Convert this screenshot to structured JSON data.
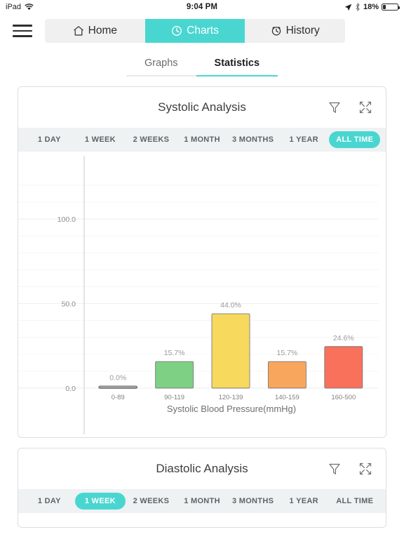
{
  "status_bar": {
    "device": "iPad",
    "wifi_icon": "wifi-icon",
    "time": "9:04 PM",
    "location_icon": "location-arrow-icon",
    "bluetooth_icon": "bluetooth-icon",
    "battery_percent": "18%",
    "battery_level": 18
  },
  "topnav": {
    "menu_icon": "hamburger-menu-icon",
    "tabs": [
      {
        "label": "Home",
        "icon": "home-icon",
        "active": false
      },
      {
        "label": "Charts",
        "icon": "clock-icon",
        "active": true
      },
      {
        "label": "History",
        "icon": "alarm-clock-icon",
        "active": false
      }
    ]
  },
  "subtabs": [
    {
      "label": "Graphs",
      "active": false
    },
    {
      "label": "Statistics",
      "active": true
    }
  ],
  "theme": {
    "accent": "#4ad6d0",
    "range_bar_bg": "#eef2f3",
    "card_border": "#dedede",
    "text": "#3d3d3d",
    "muted": "#8a8a8a"
  },
  "cards": [
    {
      "title": "Systolic Analysis",
      "filter_icon": "filter-funnel-icon",
      "expand_icon": "expand-fullscreen-icon",
      "ranges": [
        {
          "label": "1 DAY",
          "active": false
        },
        {
          "label": "1 WEEK",
          "active": false
        },
        {
          "label": "2 WEEKS",
          "active": false
        },
        {
          "label": "1 MONTH",
          "active": false
        },
        {
          "label": "3 MONTHS",
          "active": false
        },
        {
          "label": "1 YEAR",
          "active": false
        },
        {
          "label": "ALL TIME",
          "active": true
        }
      ]
    },
    {
      "title": "Diastolic Analysis",
      "filter_icon": "filter-funnel-icon",
      "expand_icon": "expand-fullscreen-icon",
      "ranges": [
        {
          "label": "1 DAY",
          "active": false
        },
        {
          "label": "1 WEEK",
          "active": true
        },
        {
          "label": "2 WEEKS",
          "active": false
        },
        {
          "label": "1 MONTH",
          "active": false
        },
        {
          "label": "3 MONTHS",
          "active": false
        },
        {
          "label": "1 YEAR",
          "active": false
        },
        {
          "label": "ALL TIME",
          "active": false
        }
      ]
    }
  ],
  "chart_data": {
    "type": "bar",
    "title": "Systolic Analysis",
    "categories": [
      "0-89",
      "90-119",
      "120-139",
      "140-159",
      "160-500"
    ],
    "values": [
      0.0,
      15.7,
      44.0,
      15.7,
      24.6
    ],
    "data_labels": [
      "0.0%",
      "15.7%",
      "44.0%",
      "15.7%",
      "24.6%"
    ],
    "colors": [
      "#808080",
      "#7ed184",
      "#f7d95e",
      "#f8a65d",
      "#f9705b"
    ],
    "xlabel": "Systolic Blood Pressure(mmHg)",
    "ylabel": "",
    "ylim": [
      0,
      120
    ],
    "yticks": [
      0.0,
      50.0,
      100.0
    ],
    "ytick_labels": [
      "0.0",
      "50.0",
      "100.0"
    ],
    "grid": true,
    "legend": false
  }
}
